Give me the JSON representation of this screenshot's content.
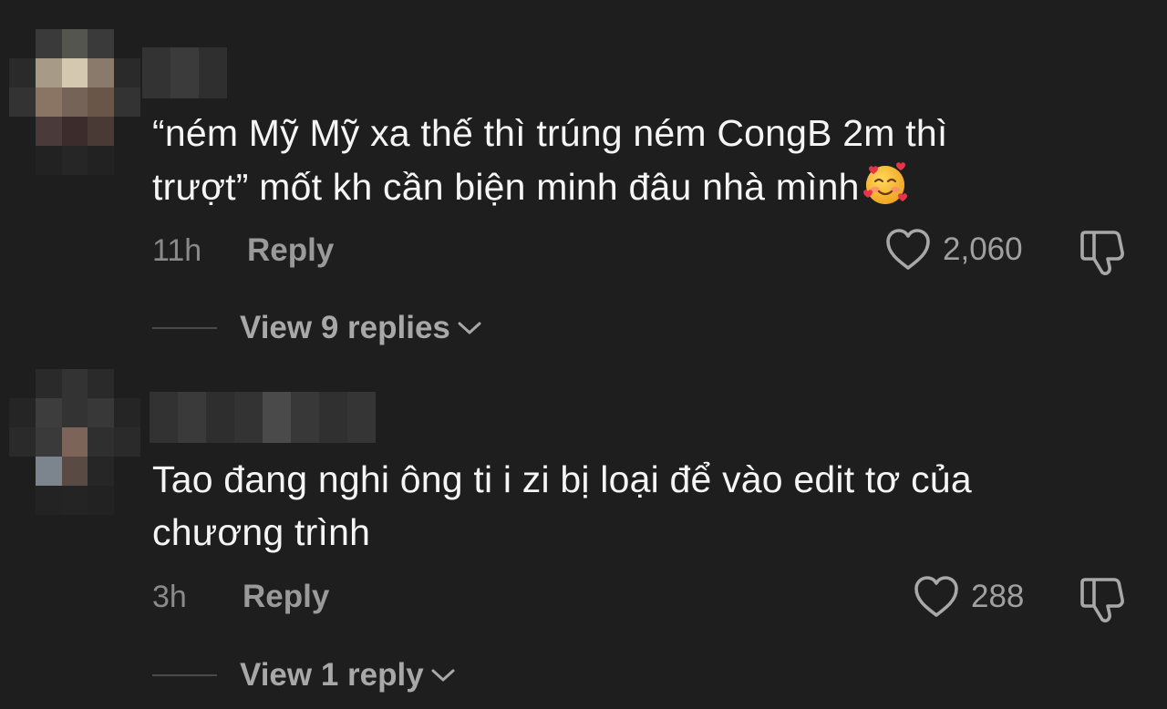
{
  "comments": [
    {
      "text_line1": "“ném Mỹ Mỹ xa thế thì trúng ném CongB 2m thì",
      "text_line2": "trượt” mốt kh cần biện minh đâu nhà mình",
      "emoji": "smiling-face-with-hearts",
      "time": "11h",
      "reply_label": "Reply",
      "likes": "2,060",
      "view_replies": "View 9 replies"
    },
    {
      "text_line1": "Tao đang nghi ông ti i zi bị loại để vào edit tơ của",
      "text_line2": "chương trình",
      "time": "3h",
      "reply_label": "Reply",
      "likes": "288",
      "view_replies": "View 1 reply"
    }
  ],
  "icons": {
    "like": "heart-outline-icon",
    "dislike": "thumbs-down-outline-icon",
    "expand": "chevron-down-icon"
  },
  "colors": {
    "background": "#1e1e1e",
    "text": "#f5f5f5",
    "secondary": "#9a9a9a"
  }
}
